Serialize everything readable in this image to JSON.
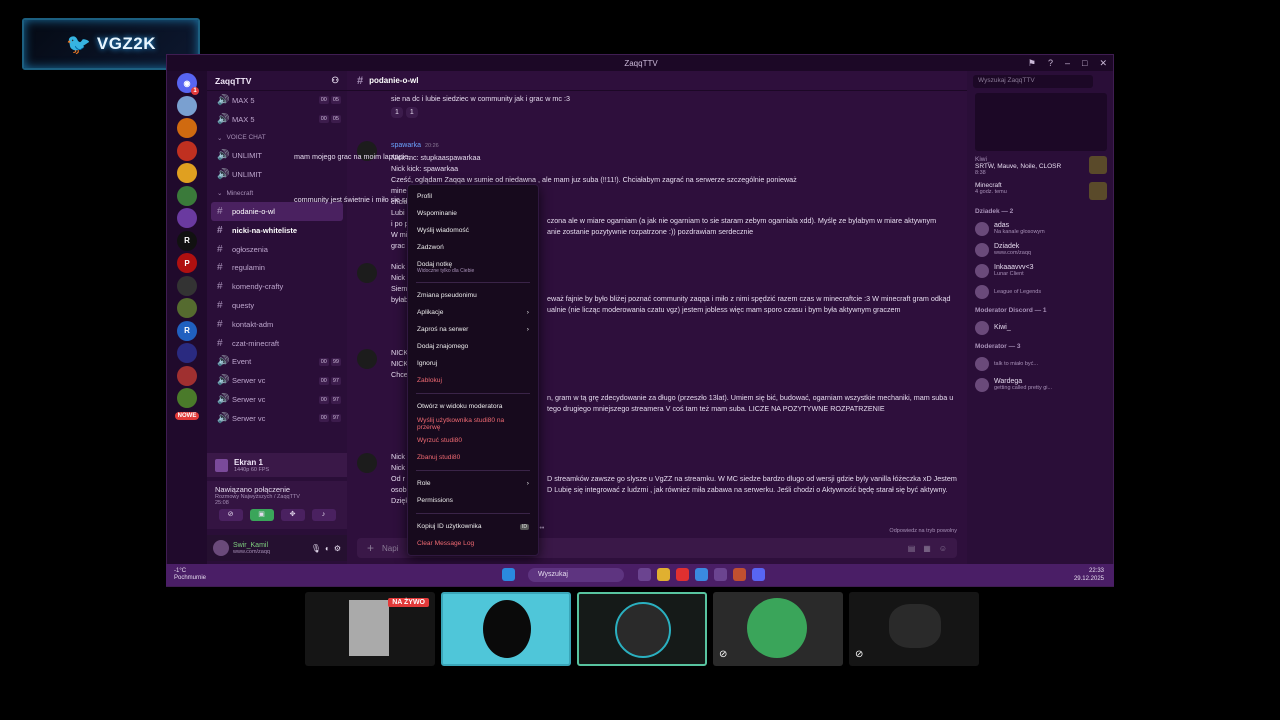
{
  "logo": {
    "text": "VGZ2K"
  },
  "window": {
    "title": "ZaqqTTV"
  },
  "servers": {
    "nowe_badge": "NOWE"
  },
  "channels": {
    "server_name": "ZaqqTTV",
    "items": [
      {
        "type": "voice",
        "label": "MAX 5",
        "c1": "00",
        "c2": "05"
      },
      {
        "type": "voice",
        "label": "MAX 5",
        "c1": "00",
        "c2": "05"
      },
      {
        "type": "category",
        "label": "VOICE CHAT"
      },
      {
        "type": "voice",
        "label": "UNLIMIT"
      },
      {
        "type": "voice",
        "label": "UNLIMIT"
      },
      {
        "type": "category",
        "label": "Minecraft"
      },
      {
        "type": "text",
        "label": "podanie-o-wl",
        "active": true
      },
      {
        "type": "text",
        "label": "nicki-na-whiteliste",
        "bold": true
      },
      {
        "type": "text",
        "label": "ogłoszenia"
      },
      {
        "type": "text",
        "label": "regulamin"
      },
      {
        "type": "text",
        "label": "komendy-crafty"
      },
      {
        "type": "text",
        "label": "questy"
      },
      {
        "type": "text",
        "label": "kontakt-adm"
      },
      {
        "type": "text",
        "label": "czat-minecraft"
      },
      {
        "type": "voice",
        "label": "Event",
        "c1": "00",
        "c2": "99"
      },
      {
        "type": "voice",
        "label": "Serwer vc",
        "c1": "00",
        "c2": "97"
      },
      {
        "type": "voice",
        "label": "Serwer vc",
        "c1": "00",
        "c2": "97"
      },
      {
        "type": "voice",
        "label": "Serwer vc",
        "c1": "00",
        "c2": "97"
      }
    ],
    "stream": {
      "title": "Ekran 1",
      "sub": "1440p 60 FPS"
    },
    "voice": {
      "status": "Nawiązano połączenie",
      "channel": "Rozmowy Najwyższych / ZaqqTTV",
      "time": "25:08"
    },
    "user": {
      "name": "Swir_Kamil",
      "status": "www.com/zaqq"
    }
  },
  "chat": {
    "channel": "podanie-o-wl",
    "messages": [
      {
        "lines": [
          "sie na dc i lubie siedziec w community jak i grac w mc :3"
        ],
        "reactions": [
          "1",
          "1"
        ]
      },
      {
        "name": "spawarka",
        "time": "20:26",
        "lines": [
          "Nick mc: stupkaaspawarkaa",
          "Nick kick: spawarkaa",
          "Cześć, oglądam Zaqqa w sumie od niedawna , ale mam juz suba (!!11!).  Chciałabym zagrać na serwerze szczególnie ponieważ",
          "minec",
          "chcia",
          "Lubi",
          "i po p",
          "W mi",
          "grac"
        ],
        "frag1": "mam mojego grac na moim laptopie,",
        "frag2": "community jest świetnie i miło sie spedza z nimi czas :3",
        "frag3": "czona ale w miare ogarniam (a jak nie ogarniam to sie staram zebym ogarniala xdd). Myślę ze bylabym w miare aktywnym",
        "frag4": "anie zostanie pozytywnie rozpatrzone :)) pozdrawiam serdecznie"
      },
      {
        "lines": [
          "Nick",
          "Nick",
          "Siem",
          "byłab"
        ],
        "frag1": "eważ fajnie by było bliżej poznać community zaqqa i miło z nimi spędzić razem czas w minecraftcie :3 W minecraft gram odkąd",
        "frag2": "ualnie (nie licząc moderowania czatu vgz) jestem jobless więc mam sporo czasu i bym była aktywnym graczem"
      },
      {
        "lines": [
          "NICK",
          "NICK",
          "Chce"
        ],
        "frag1": "n, gram w tą grę zdecydowanie za długo (przeszło 13lat). Umiem się bić, budować, ogarniam wszystkie mechaniki, mam suba u",
        "frag2": "tego drugiego mniejszego streamera V coś tam też mam suba. LICZE NA POZYTYWNE ROZPATRZENIE"
      },
      {
        "lines": [
          "Nick",
          "Nick",
          "Od r",
          "osob",
          "Dzięk"
        ],
        "frag1": "D streamków zawsze go slysze u VgZZ na streamku. W MC siedze bardzo dlugo od wersji gdzie byly vanilla łóżeczka xD Jestem",
        "frag2": "D Lubię się integrować z ludzmi , jak również miła zabawa na serwerku. Jeśli chodzi o Aktywność będę starał się być aktywny."
      }
    ],
    "typing": "Odpowiedz na tryb powolny",
    "input_placeholder": "Napi"
  },
  "members": {
    "search_placeholder": "Wyszukaj ZaqqTTV",
    "activities": [
      {
        "name": "Kiwi_",
        "status": "SRTW, Mauve, Noile, CLOSR",
        "sub": "8:38"
      },
      {
        "name": "",
        "status": "Minecraft",
        "sub": "4 godz. temu"
      }
    ],
    "groups": [
      {
        "header": "Dziadek — 2",
        "members": [
          {
            "name": "adas",
            "status": "Na kanale głosowym"
          },
          {
            "name": "Dziadek",
            "status": "www.com/zaqq"
          }
        ]
      },
      {
        "header": "Moderator Discord — 1",
        "members": [
          {
            "name": "Kiwi_",
            "status": ""
          }
        ]
      },
      {
        "header": "Moderator — 3",
        "members": [
          {
            "name": "",
            "status": "talk to miało być..."
          },
          {
            "name": "Wardega",
            "status": "getting called pretty gi..."
          }
        ]
      }
    ],
    "misc": [
      {
        "name": "Inkaaavvv<3",
        "status": "Lunar Client"
      },
      {
        "name": "",
        "status": "League of Legends"
      }
    ]
  },
  "context_menu": {
    "items": [
      {
        "label": "Profil"
      },
      {
        "label": "Wspominanie"
      },
      {
        "label": "Wyślij wiadomość"
      },
      {
        "label": "Zadzwoń"
      },
      {
        "label": "Dodaj notkę",
        "sub": "Widoczne tylko dla Ciebie"
      },
      {
        "sep": true
      },
      {
        "label": "Zmiana pseudonimu"
      },
      {
        "label": "Aplikacje",
        "arrow": true
      },
      {
        "label": "Zaproś na serwer",
        "arrow": true
      },
      {
        "label": "Dodaj znajomego"
      },
      {
        "label": "Ignoruj"
      },
      {
        "label": "Zablokuj",
        "red": true
      },
      {
        "sep": true
      },
      {
        "label": "Otwórz w widoku moderatora"
      },
      {
        "label": "Wyślij użytkownika studi80 na przerwę",
        "red": true
      },
      {
        "label": "Wyrzuć studi80",
        "red": true
      },
      {
        "label": "Zbanuj studi80",
        "red": true
      },
      {
        "sep": true
      },
      {
        "label": "Role",
        "arrow": true
      },
      {
        "label": "Permissions"
      },
      {
        "sep": true
      },
      {
        "label": "Kopiuj ID użytkownika",
        "badge": "ID"
      },
      {
        "label": "Clear Message Log",
        "red": true
      }
    ]
  },
  "taskbar": {
    "weather_temp": "-1°C",
    "weather_desc": "Pochmurnie",
    "search": "Wyszukaj",
    "time": "22:33",
    "date": "29.12.2025"
  },
  "cams": {
    "live": "NA ŻYWO"
  }
}
